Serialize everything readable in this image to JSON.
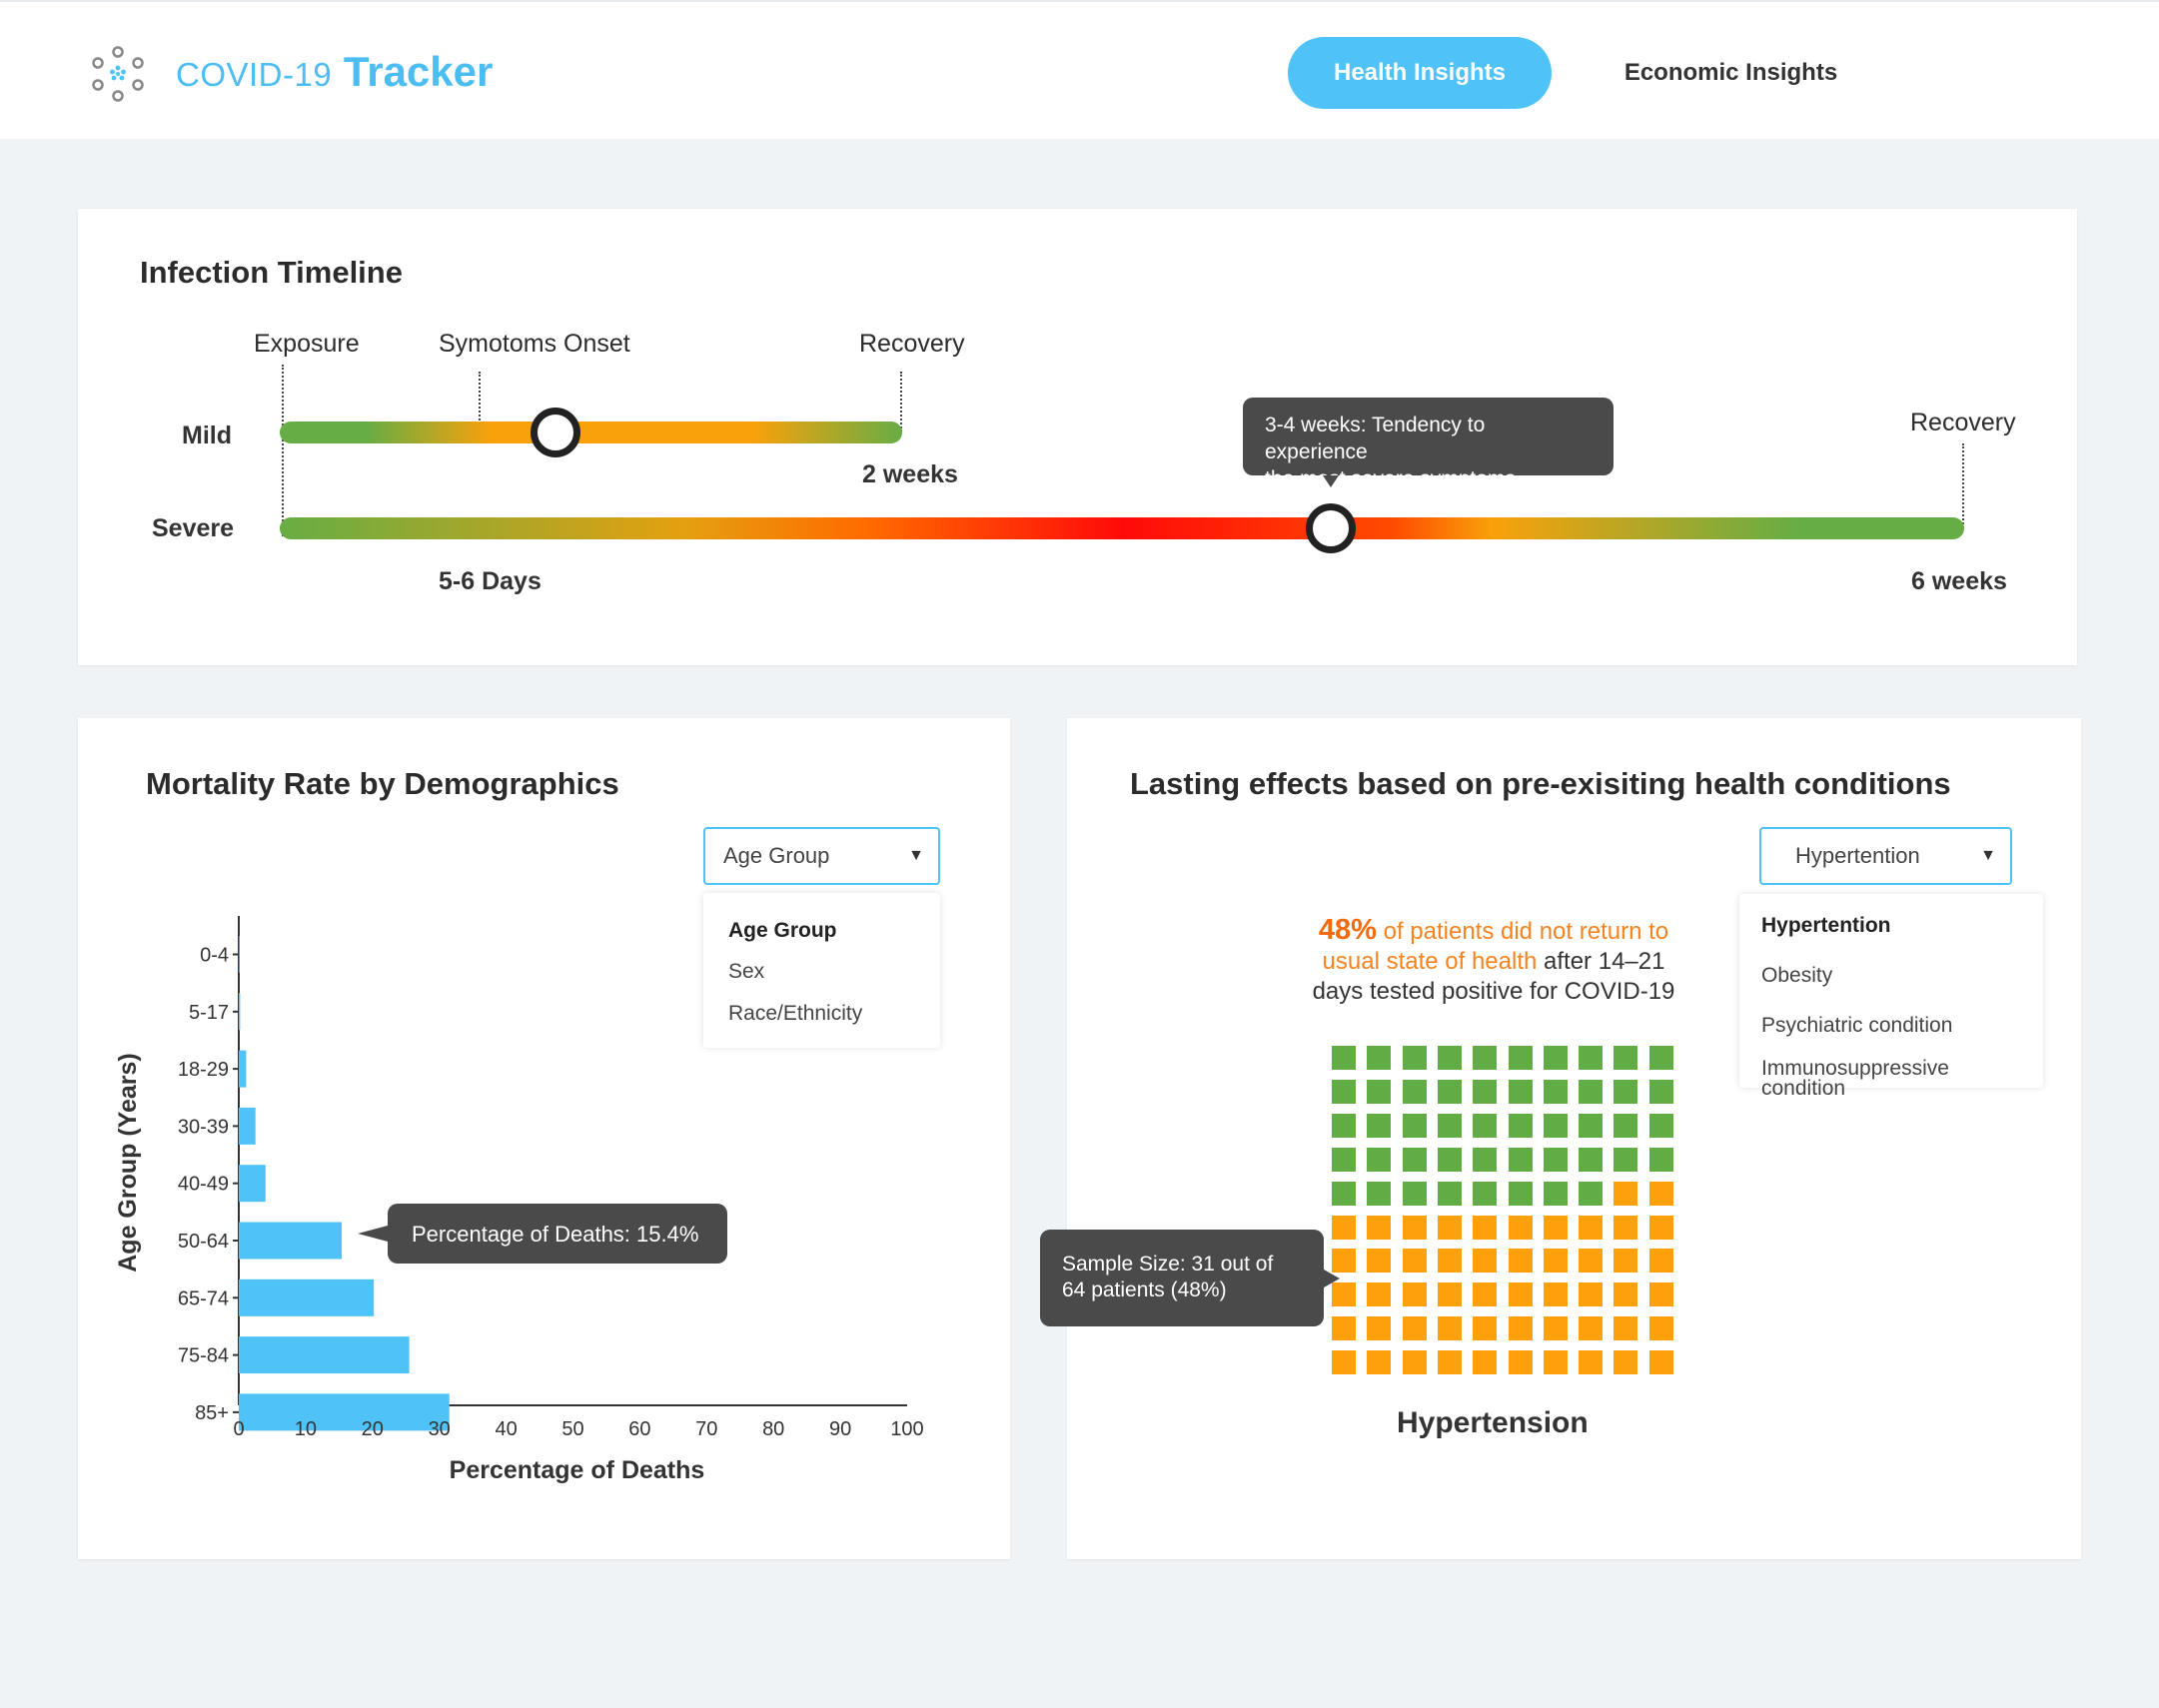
{
  "header": {
    "brand_prefix": "COVID-19",
    "brand_name": "Tracker",
    "nav": [
      {
        "label": "Health Insights",
        "active": true
      },
      {
        "label": "Economic Insights",
        "active": false
      }
    ]
  },
  "timeline": {
    "title": "Infection Timeline",
    "top_labels": {
      "exposure": "Exposure",
      "onset": "Symotoms Onset",
      "recovery_mild": "Recovery",
      "recovery_severe": "Recovery"
    },
    "rows": {
      "mild": "Mild",
      "severe": "Severe"
    },
    "durations": {
      "mild": "2 weeks",
      "onset": "5-6 Days",
      "severe": "6 weeks"
    },
    "tooltip": {
      "line1": "3-4 weeks: Tendency to experience",
      "line2": "the most severe symptoms"
    },
    "colors": {
      "green": "#67ad45",
      "orange": "#f9a10b",
      "red": "#ff0a0a"
    }
  },
  "mortality": {
    "title": "Mortality Rate by Demographics",
    "dropdown": {
      "selected": "Age Group",
      "options": [
        "Age Group",
        "Sex",
        "Race/Ethnicity"
      ]
    },
    "tooltip": "Percentage of Deaths: 15.4%",
    "chart_data": {
      "type": "bar",
      "orientation": "horizontal",
      "categories": [
        "0-4",
        "5-17",
        "18-29",
        "30-39",
        "40-49",
        "50-64",
        "65-74",
        "75-84",
        "85+"
      ],
      "values": [
        0.1,
        0.2,
        1.1,
        2.5,
        4.0,
        15.4,
        20.2,
        25.5,
        31.5
      ],
      "xlabel": "Percentage of Deaths",
      "ylabel": "Age Group (Years)",
      "xlim": [
        0,
        100
      ],
      "xticks": [
        "0",
        "10",
        "20",
        "30",
        "40",
        "50",
        "60",
        "70",
        "80",
        "90",
        "100"
      ],
      "bar_color": "#4fc3f7"
    }
  },
  "lasting": {
    "title": "Lasting effects based on pre-exisiting health conditions",
    "dropdown": {
      "selected": "Hypertention",
      "options": [
        "Hypertention",
        "Obesity",
        "Psychiatric condition",
        "Immunosuppressive",
        "condition"
      ]
    },
    "stat": {
      "pct": "48%",
      "hl1": " of patients did not return to",
      "hl2": "usual state of health",
      "rest1": " after 14–21",
      "rest2": "days tested positive for COVID-19"
    },
    "tooltip": {
      "line1": "Sample Size: 31 out of",
      "line2": "64 patients (48%)"
    },
    "waffle": {
      "total": 100,
      "orange": 52,
      "green_color": "#62ac45",
      "orange_color": "#fca10b"
    },
    "label": "Hypertension"
  }
}
